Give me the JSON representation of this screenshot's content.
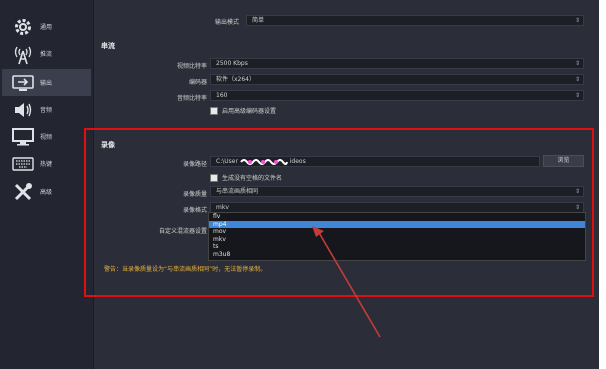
{
  "sidebar": {
    "items": [
      {
        "label": "通用",
        "icon": "gear-icon"
      },
      {
        "label": "推流",
        "icon": "broadcast-tower-icon"
      },
      {
        "label": "输出",
        "icon": "output-monitor-icon",
        "active": true
      },
      {
        "label": "音频",
        "icon": "speaker-icon"
      },
      {
        "label": "视频",
        "icon": "monitor-icon"
      },
      {
        "label": "热键",
        "icon": "keyboard-icon"
      },
      {
        "label": "高级",
        "icon": "tools-icon"
      }
    ]
  },
  "output_mode": {
    "label": "输出模式",
    "value": "简单"
  },
  "streaming": {
    "title": "串流",
    "video_bitrate_label": "视频比特率",
    "video_bitrate_value": "2500 Kbps",
    "encoder_label": "编码器",
    "encoder_value": "软件（x264）",
    "audio_bitrate_label": "音频比特率",
    "audio_bitrate_value": "160",
    "advanced_encoder_check": "启用高级编码器设置"
  },
  "recording": {
    "title": "录像",
    "path_label": "录像路径",
    "path_value": "C:\\User",
    "path_value_tail": "ideos",
    "browse_label": "浏览",
    "no_space_check": "生成没有空格的文件名",
    "quality_label": "录像质量",
    "quality_value": "与串流画质相同",
    "format_label": "录像格式",
    "format_value": "mkv",
    "format_options": [
      "flv",
      "mp4",
      "mov",
      "mkv",
      "ts",
      "m3u8"
    ],
    "format_highlight": "mp4",
    "muxer_label": "自定义混流器设置",
    "warning": "警告：当录像质量设为“与串流画质相同”时，无法暂停录制。"
  },
  "colors": {
    "accent": "#3f86d8",
    "highlight_box": "#e01010",
    "warning": "#e8b13a",
    "annotation_arrow": "#c43b3b"
  }
}
